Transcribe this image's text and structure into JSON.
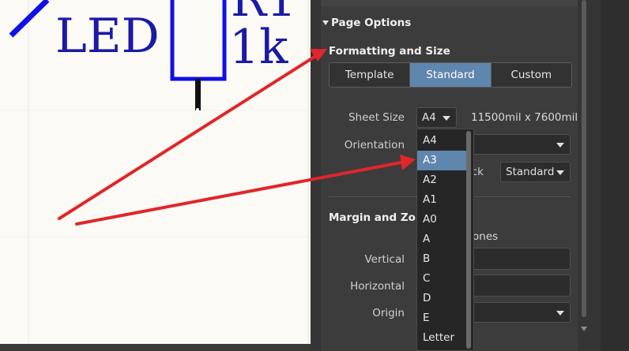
{
  "schematic": {
    "led_label": "LED",
    "resistor_designator": "R1",
    "resistor_value": "1k"
  },
  "panel": {
    "section_title": "Page Options",
    "formatting_title": "Formatting and Size",
    "tabs": [
      {
        "label": "Template",
        "active": false
      },
      {
        "label": "Standard",
        "active": true
      },
      {
        "label": "Custom",
        "active": false
      }
    ],
    "sheet_size_label": "Sheet Size",
    "sheet_size_value": "A4",
    "sheet_dimensions": "11500mil  x  7600mil",
    "orientation_label": "Orientation",
    "orientation_value": "",
    "title_block_partial_label": "ck",
    "title_block_value": "Standard",
    "margin_title_partial": "Margin and Zone",
    "show_zones_partial": "ones",
    "vertical_label": "Vertical",
    "horizontal_label": "Horizontal",
    "origin_label": "Origin"
  },
  "dropdown": {
    "options": [
      "A4",
      "A3",
      "A2",
      "A1",
      "A0",
      "A",
      "B",
      "C",
      "D",
      "E",
      "Letter"
    ],
    "highlighted": "A3"
  },
  "colors": {
    "accent": "#5f86ad",
    "annotation_arrow": "#e0262b",
    "schematic_blue": "#1a1aa6",
    "symbol_blue": "#1010e8"
  },
  "icons": {
    "collapse": "triangle-down-icon",
    "caret": "chevron-down-icon"
  }
}
